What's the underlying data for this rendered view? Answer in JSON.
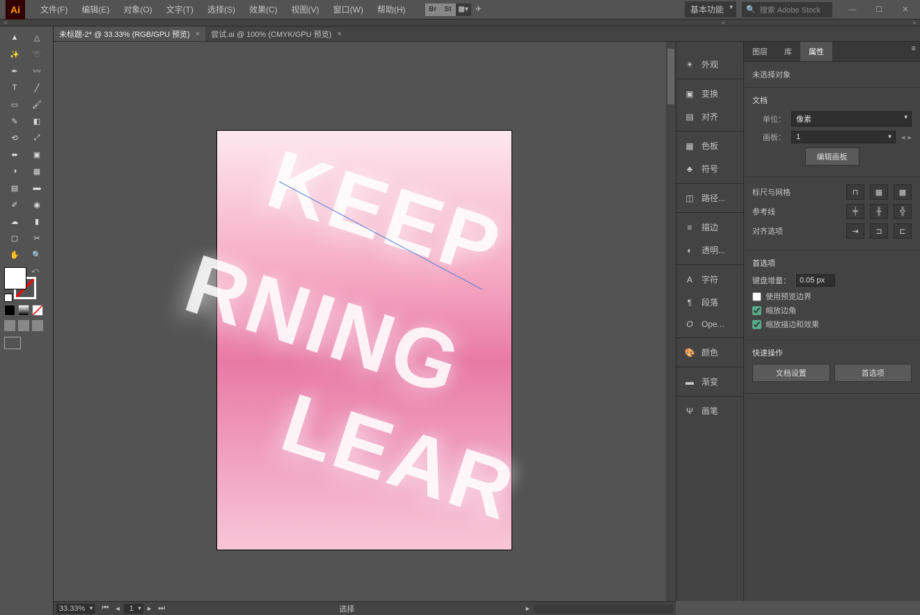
{
  "app": {
    "logo": "Ai"
  },
  "menu": {
    "items": [
      "文件(F)",
      "编辑(E)",
      "对象(O)",
      "文字(T)",
      "选择(S)",
      "效果(C)",
      "视图(V)",
      "窗口(W)",
      "帮助(H)"
    ],
    "icons": [
      "Br",
      "St"
    ],
    "workspace": "基本功能",
    "search_placeholder": "搜索 Adobe Stock"
  },
  "tabs": [
    {
      "label": "未标题-2* @ 33.33% (RGB/GPU 预览)",
      "active": true
    },
    {
      "label": "尝试.ai @ 100% (CMYK/GPU 预览)",
      "active": false
    }
  ],
  "artboard": {
    "text_lines": [
      "KEEP",
      "RNING",
      "LEAR"
    ]
  },
  "panel_strip": [
    "外观",
    "变换",
    "对齐",
    "色板",
    "符号",
    "路径...",
    "描边",
    "透明...",
    "字符",
    "段落",
    "Ope...",
    "颜色",
    "渐变",
    "画笔"
  ],
  "right_panel": {
    "tabs": [
      "图层",
      "库",
      "属性"
    ],
    "active_tab": "属性",
    "no_sel": "未选择对象",
    "doc_title": "文档",
    "units_label": "单位：",
    "units_value": "像素",
    "artboard_label": "画板：",
    "artboard_value": "1",
    "edit_artboard_btn": "编辑画板",
    "rulers_grid_title": "标尺与网格",
    "guides_title": "参考线",
    "align_opts_title": "对齐选项",
    "prefs_title": "首选项",
    "kbd_incr_label": "键盘增量：",
    "kbd_incr_value": "0.05 px",
    "checkbox_preview": "使用预览边界",
    "checkbox_scale_corners": "缩放边角",
    "checkbox_scale_strokes": "缩放描边和效果",
    "quick_title": "快速操作",
    "btn_doc_setup": "文档设置",
    "btn_prefs": "首选项"
  },
  "status": {
    "zoom": "33.33%",
    "page": "1",
    "mode": "选择"
  }
}
